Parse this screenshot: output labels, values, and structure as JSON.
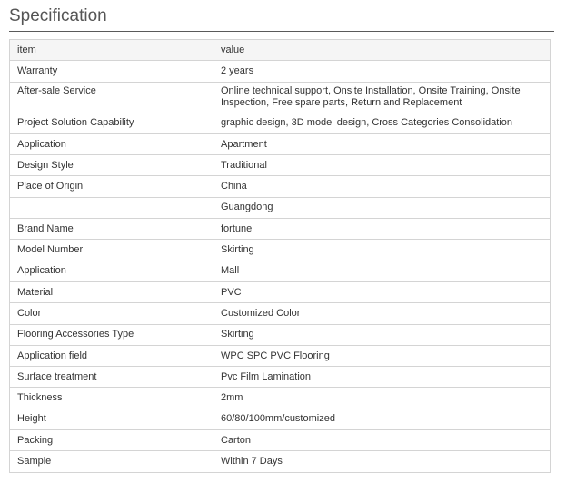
{
  "title": "Specification",
  "table": {
    "header": {
      "item": "item",
      "value": "value"
    },
    "rows": [
      {
        "item": "Warranty",
        "value": "2 years"
      },
      {
        "item": "After-sale Service",
        "value": "Online technical support, Onsite Installation, Onsite Training, Onsite Inspection, Free spare parts, Return and Replacement"
      },
      {
        "item": "Project Solution Capability",
        "value": "graphic design, 3D model design, Cross Categories Consolidation"
      },
      {
        "item": "Application",
        "value": "Apartment"
      },
      {
        "item": "Design Style",
        "value": "Traditional"
      },
      {
        "item": "Place of Origin",
        "value": "China"
      },
      {
        "item": "",
        "value": "Guangdong"
      },
      {
        "item": "Brand Name",
        "value": "fortune"
      },
      {
        "item": "Model Number",
        "value": "Skirting"
      },
      {
        "item": "Application",
        "value": "Mall"
      },
      {
        "item": "Material",
        "value": "PVC"
      },
      {
        "item": "Color",
        "value": "Customized Color"
      },
      {
        "item": "Flooring Accessories Type",
        "value": "Skirting"
      },
      {
        "item": "Application field",
        "value": "WPC SPC PVC Flooring"
      },
      {
        "item": "Surface treatment",
        "value": "Pvc Film Lamination"
      },
      {
        "item": "Thickness",
        "value": "2mm"
      },
      {
        "item": "Height",
        "value": "60/80/100mm/customized"
      },
      {
        "item": "Packing",
        "value": "Carton"
      },
      {
        "item": "Sample",
        "value": "Within 7 Days"
      }
    ]
  }
}
